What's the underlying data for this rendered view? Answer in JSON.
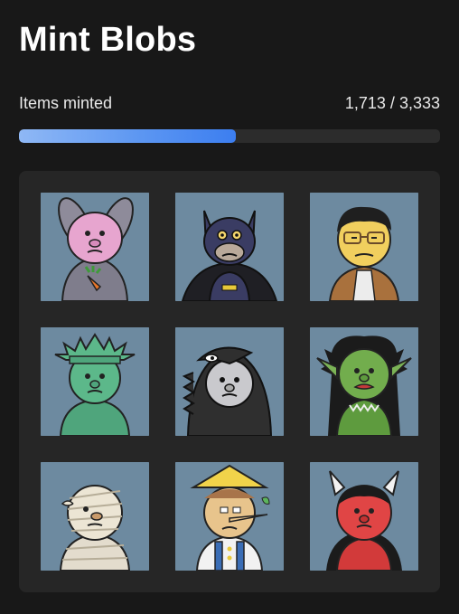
{
  "collection": {
    "title": "Mint Blobs"
  },
  "progress": {
    "label": "Items minted",
    "minted_text": "1,713",
    "separator": "/",
    "total_text": "3,333",
    "minted": 1713,
    "total": 3333,
    "bar_color": "#4a8af2"
  },
  "gallery": {
    "background": "#6d8aa0",
    "items": [
      {
        "character": "pink-bunny"
      },
      {
        "character": "bat-hero"
      },
      {
        "character": "yellow-man-glasses"
      },
      {
        "character": "liberty-statue"
      },
      {
        "character": "godzilla"
      },
      {
        "character": "green-troll"
      },
      {
        "character": "mummy"
      },
      {
        "character": "pinocchio"
      },
      {
        "character": "red-oni"
      }
    ]
  }
}
